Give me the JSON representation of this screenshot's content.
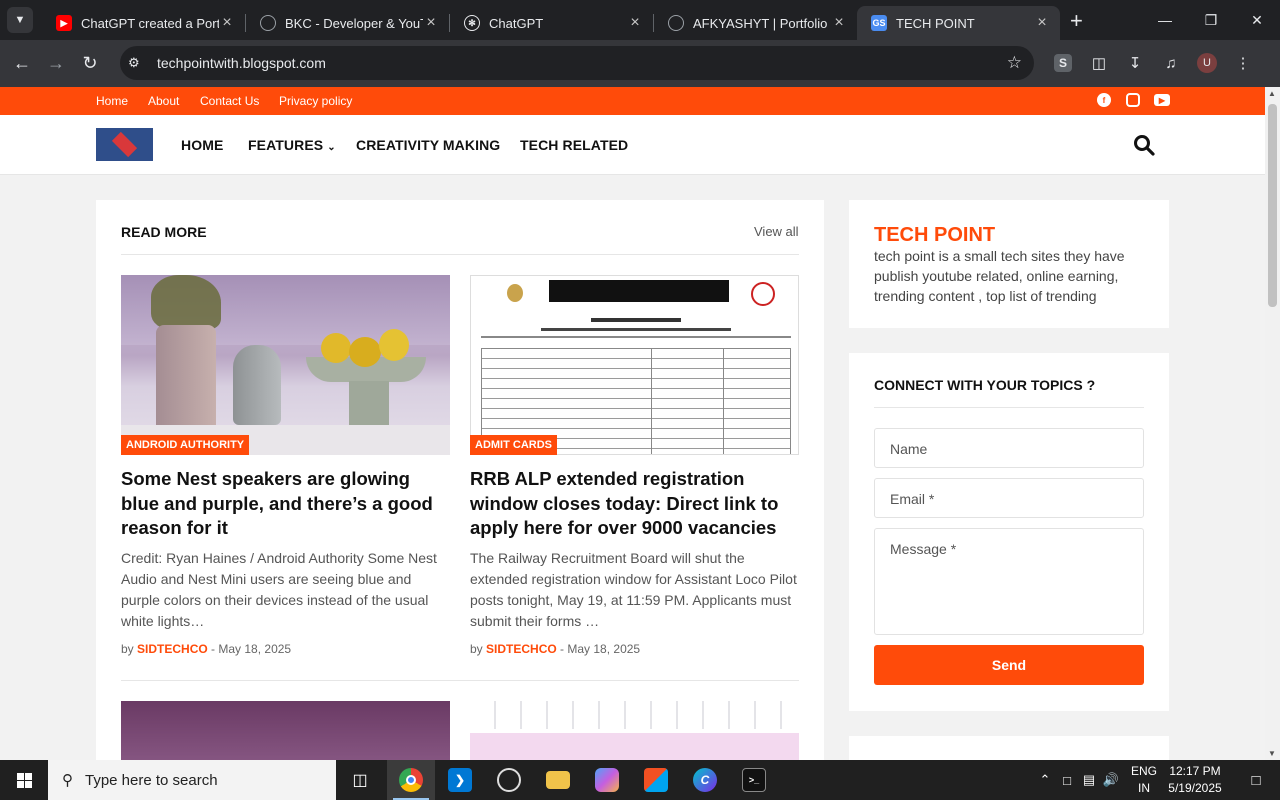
{
  "browser": {
    "tabs": [
      {
        "title": "ChatGPT created a Portfo",
        "icon": "youtube-icon",
        "color": "#ff0000"
      },
      {
        "title": "BKC - Developer & YouTu",
        "icon": "globe-icon",
        "color": "#9aa0a6"
      },
      {
        "title": "ChatGPT",
        "icon": "chatgpt-icon",
        "color": "#e8eaed"
      },
      {
        "title": "AFKYASHYT | Portfolio",
        "icon": "globe-icon",
        "color": "#9aa0a6"
      },
      {
        "title": "TECH POINT",
        "icon": "gs-icon",
        "color": "#4a8cf0"
      }
    ],
    "url": "techpointwith.blogspot.com",
    "profile_initial": "U"
  },
  "site": {
    "top_links": [
      "Home",
      "About",
      "Contact Us",
      "Privacy policy"
    ],
    "social_icons": [
      "facebook-icon",
      "instagram-icon",
      "youtube-icon"
    ],
    "nav": {
      "home": "HOME",
      "features": "FEATURES",
      "creativity": "CREATIVITY MAKING",
      "tech": "TECH RELATED"
    },
    "accent": "#ff4b0a"
  },
  "main": {
    "section_title": "READ MORE",
    "view_all": "View all",
    "posts": [
      {
        "badge": "ANDROID AUTHORITY",
        "title": "Some Nest speakers are glowing blue and purple, and there’s a good reason for it",
        "snippet": "Credit: Ryan Haines / Android Authority Some Nest Audio and Nest Mini users are seeing blue and purple colors on their devices instead of the usual white lights…",
        "by": "by",
        "author": "SIDTECHCO",
        "date": "- May 18, 2025"
      },
      {
        "badge": "ADMIT CARDS",
        "title": "RRB ALP extended registration window closes today: Direct link to apply here for over 9000 vacancies",
        "snippet": "The Railway Recruitment Board will shut the extended registration window for Assistant Loco Pilot posts tonight, May 19, at 11:59 PM. Applicants must submit their forms …",
        "by": "by",
        "author": "SIDTECHCO",
        "date": "- May 18, 2025"
      }
    ]
  },
  "sidebar": {
    "about_title": "TECH POINT",
    "about_text": "tech point is a small tech sites they have publish youtube related, online earning, trending content , top list of trending",
    "contact_title": "CONNECT WITH YOUR TOPICS ?",
    "name_placeholder": "Name",
    "email_placeholder": "Email *",
    "message_placeholder": "Message *",
    "send_label": "Send"
  },
  "taskbar": {
    "search_placeholder": "Type here to search",
    "lang": "ENG",
    "region": "IN",
    "time": "12:17 PM",
    "date": "5/19/2025"
  }
}
